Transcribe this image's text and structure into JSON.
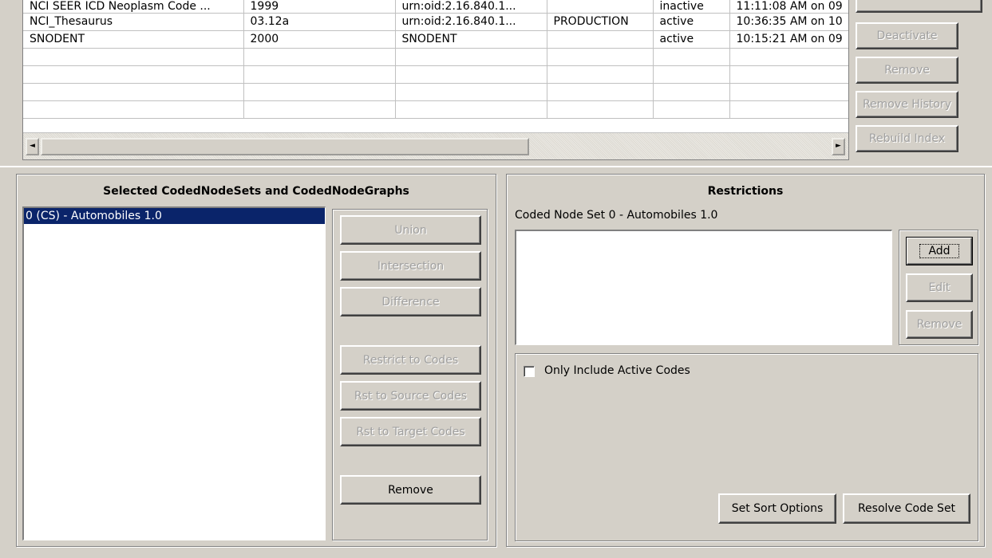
{
  "code_systems": {
    "rows": [
      [
        "NCI SEER ICD Neoplasm Code ...",
        "1999",
        "urn:oid:2.16.840.1...",
        "",
        "inactive",
        "11:11:08 AM on 09"
      ],
      [
        "NCI_Thesaurus",
        "03.12a",
        "urn:oid:2.16.840.1...",
        "PRODUCTION",
        "active",
        "10:36:35 AM on 10"
      ],
      [
        "SNODENT",
        "2000",
        "SNODENT",
        "",
        "active",
        "10:15:21 AM on 09"
      ],
      [
        "",
        "",
        "",
        "",
        "",
        ""
      ],
      [
        "",
        "",
        "",
        "",
        "",
        ""
      ],
      [
        "",
        "",
        "",
        "",
        "",
        ""
      ],
      [
        "",
        "",
        "",
        "",
        "",
        ""
      ]
    ],
    "scroll_left_glyph": "◄",
    "scroll_right_glyph": "►"
  },
  "side_buttons": {
    "deactivate": "Deactivate",
    "remove": "Remove",
    "remove_history": "Remove History",
    "rebuild_index": "Rebuild Index"
  },
  "selected_panel": {
    "title": "Selected CodedNodeSets and CodedNodeGraphs",
    "items": [
      "0 (CS) - Automobiles 1.0"
    ],
    "buttons": {
      "union": "Union",
      "intersection": "Intersection",
      "difference": "Difference",
      "restrict_codes": "Restrict to Codes",
      "rst_source": "Rst to Source Codes",
      "rst_target": "Rst to Target Codes",
      "remove": "Remove"
    }
  },
  "restrictions_panel": {
    "title": "Restrictions",
    "subtitle": "Coded Node Set 0 - Automobiles 1.0",
    "buttons": {
      "add": "Add",
      "edit": "Edit",
      "remove": "Remove"
    },
    "only_active_label": "Only Include Active Codes",
    "only_active_checked": false,
    "set_sort_options": "Set Sort Options",
    "resolve_code_set": "Resolve Code Set"
  }
}
